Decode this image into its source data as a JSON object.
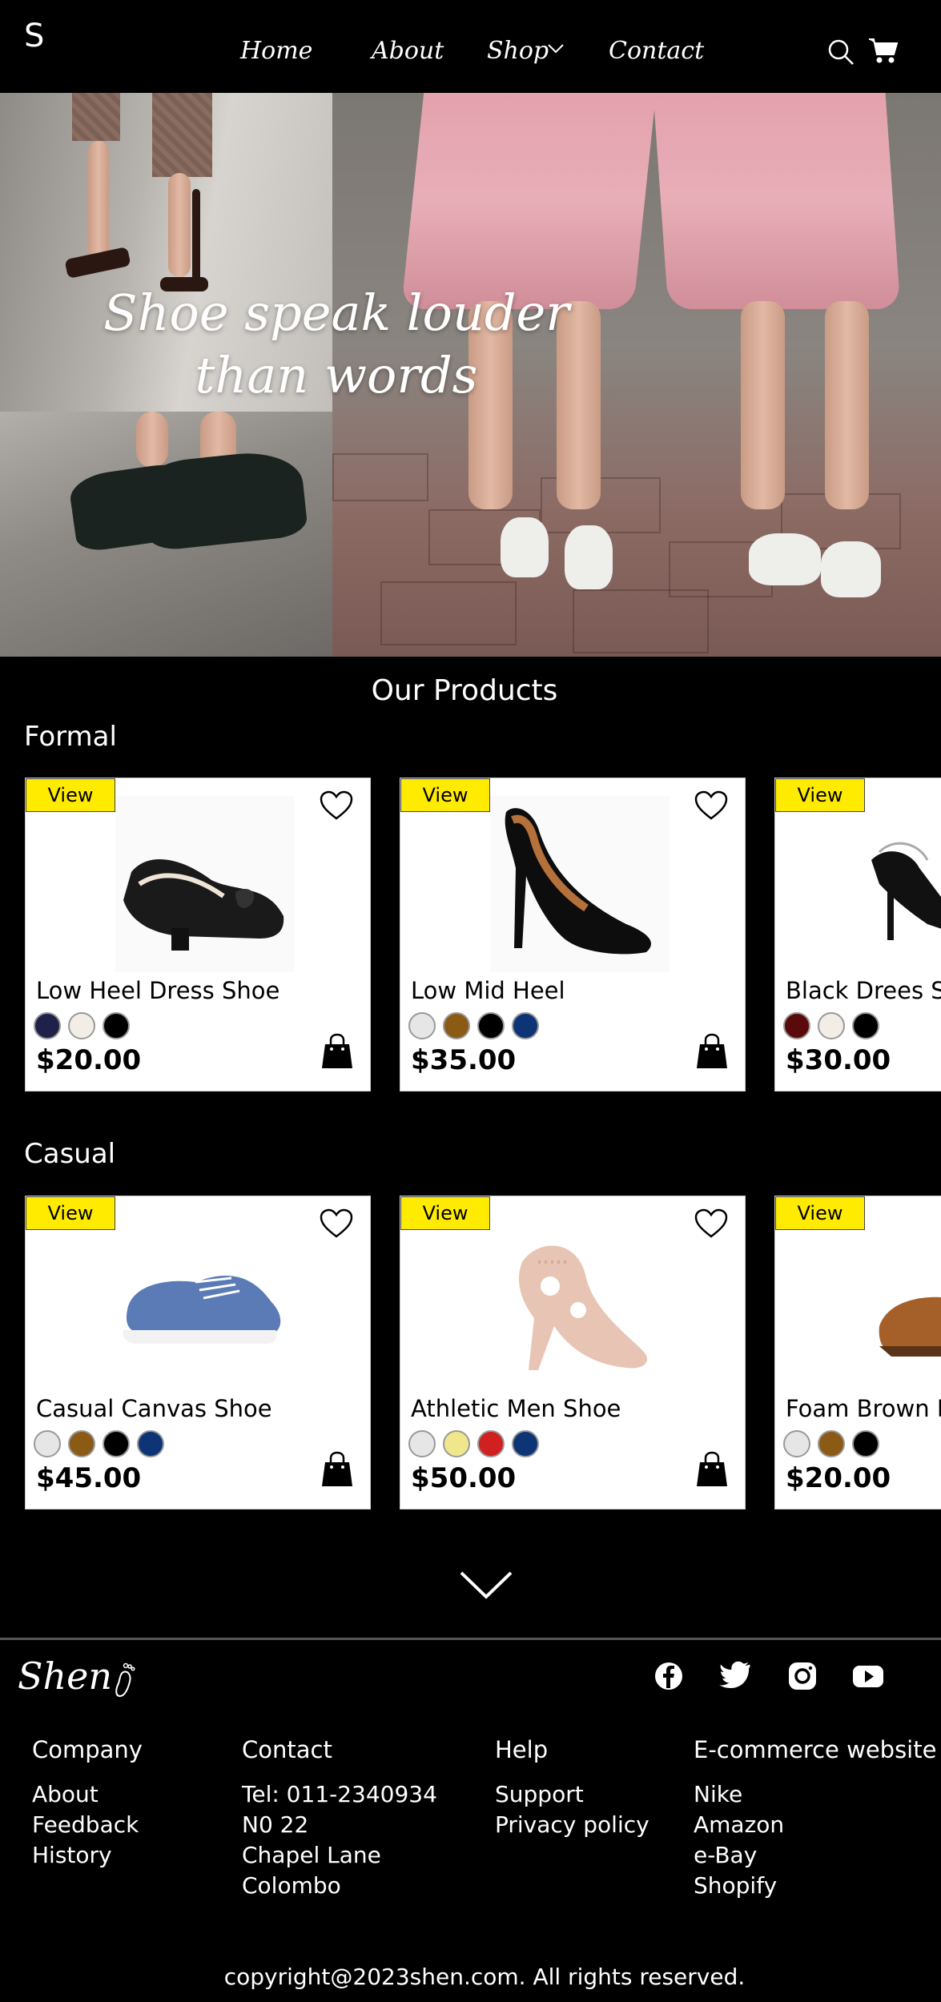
{
  "nav": {
    "logo": "S",
    "links": {
      "home": "Home",
      "about": "About",
      "shop": "Shop",
      "contact": "Contact"
    }
  },
  "hero": {
    "title_line1": "Shoe speak louder",
    "title_line2": "than words"
  },
  "products": {
    "heading": "Our Products",
    "categories": [
      {
        "name": "Formal",
        "items": [
          {
            "view": "View",
            "name": "Low Heel Dress Shoe",
            "price": "$20.00",
            "colors": [
              "#1f2148",
              "#f2eee6",
              "#000000"
            ],
            "icon": "black-flat-shoe"
          },
          {
            "view": "View",
            "name": "Low Mid Heel",
            "price": "$35.00",
            "colors": [
              "#e6e6e6",
              "#8b5a14",
              "#000000",
              "#0d3575"
            ],
            "icon": "black-pump-heel"
          },
          {
            "view": "View",
            "name": "Black Drees Shoe",
            "price": "$30.00",
            "colors": [
              "#5a0a0a",
              "#f2eee6",
              "#000000"
            ],
            "icon": "black-strap-heel"
          }
        ]
      },
      {
        "name": "Casual",
        "items": [
          {
            "view": "View",
            "name": "Casual Canvas Shoe",
            "price": "$45.00",
            "colors": [
              "#e6e6e6",
              "#8b5a14",
              "#000000",
              "#0d3575"
            ],
            "icon": "blue-canvas-sneaker"
          },
          {
            "view": "View",
            "name": "Athletic Men Shoe",
            "price": "$50.00",
            "colors": [
              "#e6e6e6",
              "#f0e68c",
              "#d02020",
              "#0d3575"
            ],
            "icon": "pink-cutout-heel"
          },
          {
            "view": "View",
            "name": "Foam Brown Footwear",
            "price": "$20.00",
            "colors": [
              "#e6e6e6",
              "#8b5a14",
              "#000000"
            ],
            "icon": "brown-loafer"
          }
        ]
      }
    ]
  },
  "footer": {
    "logo": "Shen",
    "company": {
      "heading": "Company",
      "links": [
        "About",
        "Feedback",
        "History"
      ]
    },
    "contact": {
      "heading": "Contact",
      "lines": [
        "Tel: 011-2340934",
        "N0 22",
        "Chapel Lane",
        "Colombo"
      ]
    },
    "help": {
      "heading": "Help",
      "links": [
        "Support",
        "Privacy policy"
      ]
    },
    "ecommerce": {
      "heading": "E-commerce website",
      "links": [
        "Nike",
        "Amazon",
        "e-Bay",
        "Shopify"
      ]
    },
    "social": [
      "facebook-icon",
      "twitter-icon",
      "instagram-icon",
      "youtube-icon"
    ],
    "copyright": "copyright@2023shen.com. All rights reserved."
  }
}
